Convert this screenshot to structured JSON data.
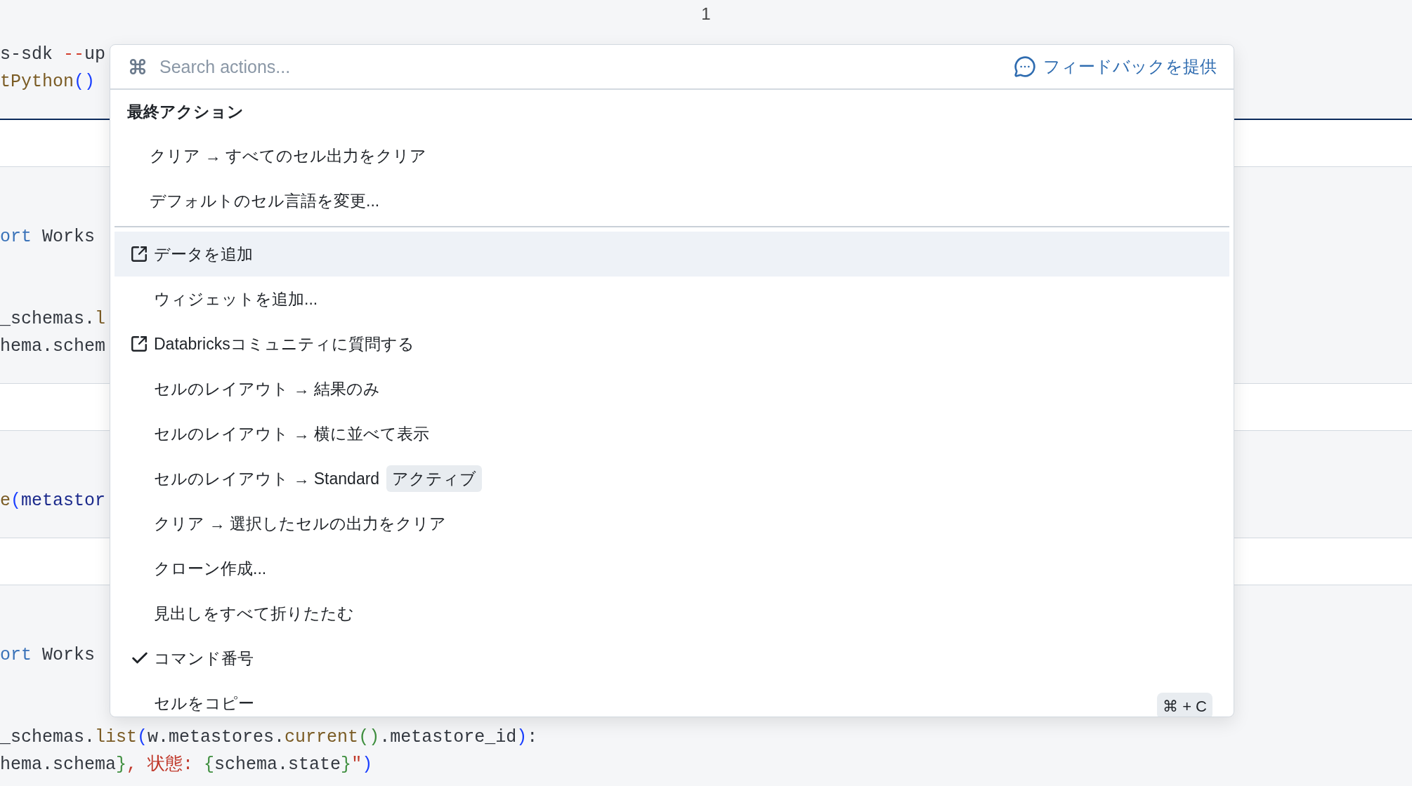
{
  "notebook": {
    "page_number": "1",
    "cells": [
      {
        "kind": "code",
        "selected": true,
        "lines": [
          {
            "kind": "code",
            "tokens": [
              {
                "text": "s-sdk ",
                "kind": "plain"
              },
              {
                "text": "--",
                "kind": "operator"
              },
              {
                "text": "up",
                "kind": "plain"
              }
            ]
          },
          {
            "kind": "code",
            "tokens": [
              {
                "text": "tPython",
                "kind": "function"
              },
              {
                "text": "()",
                "kind": "paren"
              }
            ]
          }
        ]
      },
      {
        "kind": "output",
        "selected": false
      },
      {
        "kind": "code",
        "selected": false,
        "lines": [
          {
            "kind": "blank"
          },
          {
            "kind": "blank"
          },
          {
            "kind": "code",
            "tokens": [
              {
                "text": "ort",
                "kind": "keyword"
              },
              {
                "text": " Works",
                "kind": "plain"
              }
            ]
          },
          {
            "kind": "blank"
          },
          {
            "kind": "blank"
          },
          {
            "kind": "code",
            "tokens": [
              {
                "text": "_schemas.",
                "kind": "plain"
              },
              {
                "text": "l",
                "kind": "function"
              }
            ]
          },
          {
            "kind": "code",
            "tokens": [
              {
                "text": "hema.schem",
                "kind": "plain"
              }
            ]
          }
        ]
      },
      {
        "kind": "output",
        "selected": false
      },
      {
        "kind": "code",
        "selected": false,
        "lines": [
          {
            "kind": "blank"
          },
          {
            "kind": "blank"
          },
          {
            "kind": "code",
            "tokens": [
              {
                "text": "e",
                "kind": "function"
              },
              {
                "text": "(",
                "kind": "paren"
              },
              {
                "text": "metastor",
                "kind": "variable"
              }
            ]
          }
        ]
      },
      {
        "kind": "output",
        "selected": false
      },
      {
        "kind": "code",
        "selected": false,
        "lines": [
          {
            "kind": "blank"
          },
          {
            "kind": "blank"
          },
          {
            "kind": "code",
            "tokens": [
              {
                "text": "ort",
                "kind": "keyword"
              },
              {
                "text": " Works",
                "kind": "plain"
              }
            ]
          },
          {
            "kind": "blank"
          },
          {
            "kind": "blank"
          },
          {
            "kind": "code",
            "tokens": [
              {
                "text": "_schemas.",
                "kind": "plain"
              },
              {
                "text": "list",
                "kind": "function"
              },
              {
                "text": "(",
                "kind": "paren"
              },
              {
                "text": "w.metastores.",
                "kind": "plain"
              },
              {
                "text": "current",
                "kind": "function"
              },
              {
                "text": "()",
                "kind": "brace"
              },
              {
                "text": ".metastore_id",
                "kind": "plain"
              },
              {
                "text": ")",
                "kind": "paren"
              },
              {
                "text": ":",
                "kind": "plain"
              }
            ]
          },
          {
            "kind": "code",
            "tokens": [
              {
                "text": "hema.schema",
                "kind": "plain"
              },
              {
                "text": "}",
                "kind": "brace"
              },
              {
                "text": ", 状態: ",
                "kind": "string"
              },
              {
                "text": "{",
                "kind": "brace"
              },
              {
                "text": "schema.state",
                "kind": "plain"
              },
              {
                "text": "}",
                "kind": "brace"
              },
              {
                "text": "\"",
                "kind": "string"
              },
              {
                "text": ")",
                "kind": "paren"
              }
            ]
          }
        ]
      }
    ]
  },
  "palette": {
    "search": {
      "placeholder": "Search actions..."
    },
    "feedback_link": "フィードバックを提供",
    "sections": [
      {
        "title": "最終アクション",
        "items": [
          {
            "label": "クリア → すべてのセル出力をクリア",
            "kind": "action",
            "checked": false,
            "selected": false
          },
          {
            "label": "デフォルトのセル言語を変更...",
            "kind": "action",
            "checked": false,
            "selected": false
          }
        ]
      },
      {
        "items": [
          {
            "label": "データを追加",
            "kind": "external",
            "checked": false,
            "selected": true
          },
          {
            "label": "ウィジェットを追加...",
            "kind": "action",
            "checked": false,
            "selected": false
          },
          {
            "label": "Databricksコミュニティに質問する",
            "kind": "external",
            "checked": false,
            "selected": false
          },
          {
            "label": "セルのレイアウト → 結果のみ",
            "kind": "action",
            "checked": false,
            "selected": false
          },
          {
            "label": "セルのレイアウト → 横に並べて表示",
            "kind": "action",
            "checked": false,
            "selected": false
          },
          {
            "label": "セルのレイアウト → Standard",
            "kind": "action",
            "checked": false,
            "selected": false,
            "badge": "アクティブ"
          },
          {
            "label": "クリア → 選択したセルの出力をクリア",
            "kind": "action",
            "checked": false,
            "selected": false
          },
          {
            "label": "クローン作成...",
            "kind": "action",
            "checked": false,
            "selected": false
          },
          {
            "label": "見出しをすべて折りたたむ",
            "kind": "action",
            "checked": false,
            "selected": false
          },
          {
            "label": "コマンド番号",
            "kind": "action",
            "checked": true,
            "selected": false
          },
          {
            "label": "セルをコピー",
            "kind": "action",
            "checked": false,
            "selected": false,
            "shortcut": "⌘ + C"
          }
        ]
      }
    ]
  }
}
